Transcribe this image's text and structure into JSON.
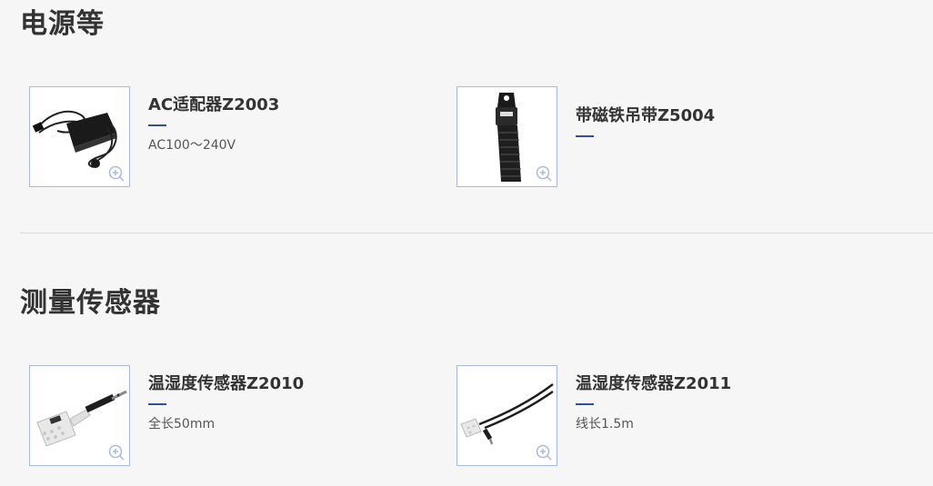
{
  "sections": [
    {
      "title": "电源等",
      "products": [
        {
          "name": "AC适配器Z2003",
          "spec": "AC100～240V",
          "image_icon": "ac-adapter-image"
        },
        {
          "name": "带磁铁吊带Z5004",
          "spec": "",
          "image_icon": "magnetic-strap-image"
        }
      ]
    },
    {
      "title": "测量传感器",
      "products": [
        {
          "name": "温湿度传感器Z2010",
          "spec": "全长50mm",
          "image_icon": "humidity-sensor-short-image"
        },
        {
          "name": "温湿度传感器Z2011",
          "spec": "线长1.5m",
          "image_icon": "humidity-sensor-cable-image"
        }
      ]
    }
  ],
  "colors": {
    "accent": "#2f4f9f",
    "thumb_border": "#a9b9de",
    "background": "#f6f6f7",
    "zoom_icon": "#a9b9de"
  },
  "icons": {
    "zoom": "zoom-in-icon"
  }
}
